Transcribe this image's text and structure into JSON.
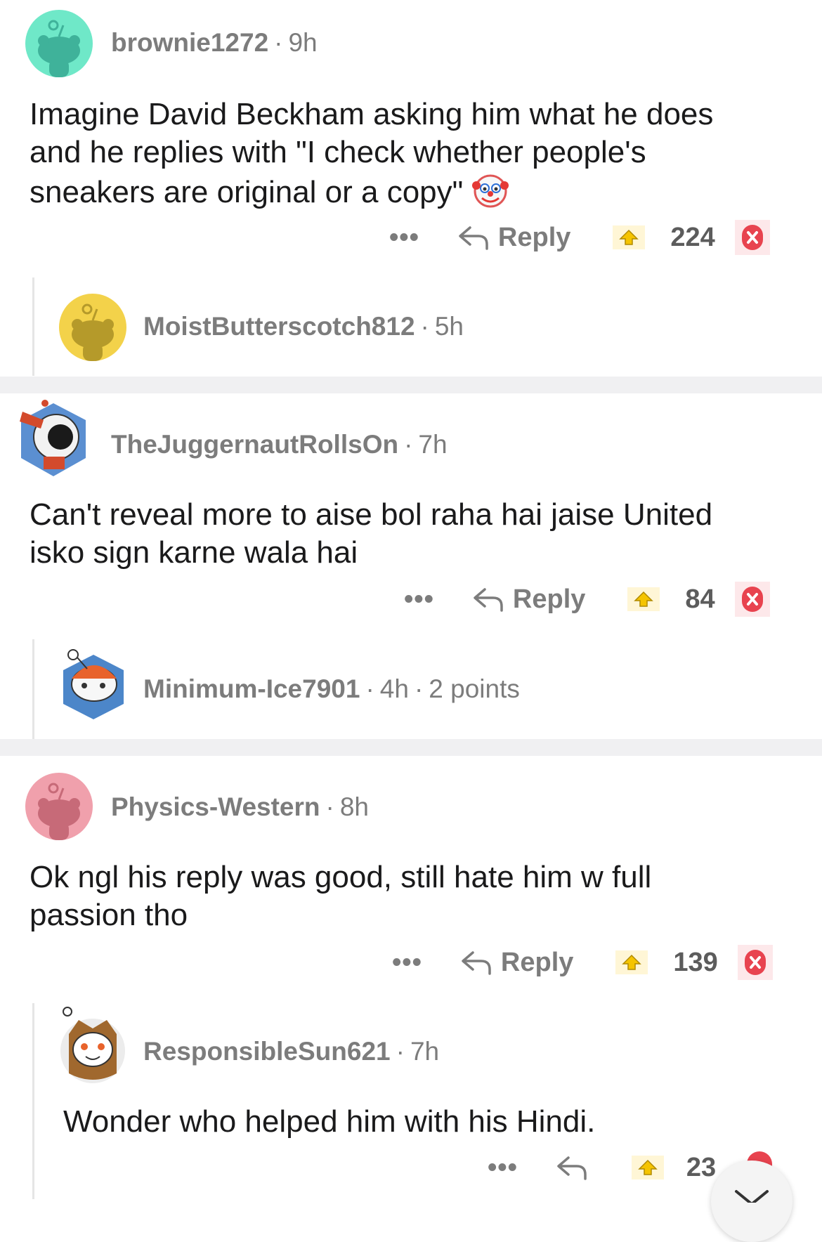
{
  "comments": [
    {
      "username": "brownie1272",
      "time": "9h",
      "text": "Imagine David Beckham asking him what he does and he replies with \"I check whether people's sneakers are original or a copy\"",
      "emoji": "clown-face",
      "more": "•••",
      "reply_label": "Reply",
      "score": "224",
      "avatar_color": "#6fe8c8",
      "reply": {
        "username": "MoistButterscotch812",
        "time": "5h",
        "avatar_color": "#f3d24a"
      }
    },
    {
      "username": "TheJuggernautRollsOn",
      "time": "7h",
      "text": "Can't reveal more to aise bol raha hai jaise United isko sign karne wala hai",
      "more": "•••",
      "reply_label": "Reply",
      "score": "84",
      "reply": {
        "username": "Minimum-Ice7901",
        "time": "4h",
        "points": "2 points"
      }
    },
    {
      "username": "Physics-Western",
      "time": "8h",
      "text": "Ok ngl his reply was good, still hate him w full passion tho",
      "more": "•••",
      "reply_label": "Reply",
      "score": "139",
      "avatar_color": "#f0a0ac",
      "reply": {
        "username": "ResponsibleSun621",
        "time": "7h",
        "text": "Wonder who helped him with his Hindi.",
        "more": "•••",
        "score": "23"
      }
    }
  ],
  "colors": {
    "upvote": "#f5c400",
    "downvote": "#e8434f",
    "meta": "#7c7c7c",
    "separator": "#f0f0f2"
  }
}
